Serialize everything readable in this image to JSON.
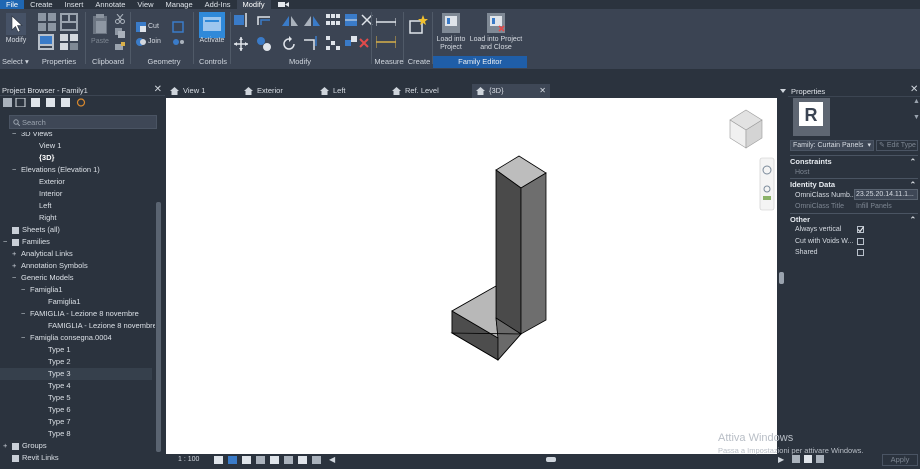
{
  "menubar": {
    "items": [
      "File",
      "Create",
      "Insert",
      "Annotate",
      "View",
      "Manage",
      "Add-Ins",
      "Modify"
    ],
    "active": "Modify"
  },
  "ribbon": {
    "modify_label": "Modify",
    "cut_label": "Cut",
    "join_label": "Join",
    "paste_label": "Paste",
    "activate_label": "Activate",
    "load_into_project_label": "Load into Project",
    "load_into_project_close_label": "Load into Project and Close",
    "panels": {
      "select": "Select",
      "properties": "Properties",
      "clipboard": "Clipboard",
      "geometry": "Geometry",
      "controls": "Controls",
      "modify": "Modify",
      "measure": "Measure",
      "create": "Create",
      "family_editor": "Family Editor"
    }
  },
  "project_browser": {
    "title": "Project Browser - Family1",
    "search_placeholder": "Search",
    "items": [
      {
        "label": "3D Views",
        "indent": 1,
        "exp": "−"
      },
      {
        "label": "View 1",
        "indent": 3,
        "exp": ""
      },
      {
        "label": "{3D}",
        "indent": 3,
        "exp": "",
        "selected": true
      },
      {
        "label": "Elevations (Elevation 1)",
        "indent": 1,
        "exp": "−"
      },
      {
        "label": "Exterior",
        "indent": 3,
        "exp": ""
      },
      {
        "label": "Interior",
        "indent": 3,
        "exp": ""
      },
      {
        "label": "Left",
        "indent": 3,
        "exp": ""
      },
      {
        "label": "Right",
        "indent": 3,
        "exp": ""
      },
      {
        "label": "Sheets (all)",
        "indent": 0,
        "exp": "",
        "icon": true
      },
      {
        "label": "Families",
        "indent": 0,
        "exp": "−",
        "icon": true
      },
      {
        "label": "Analytical Links",
        "indent": 1,
        "exp": "+"
      },
      {
        "label": "Annotation Symbols",
        "indent": 1,
        "exp": "+"
      },
      {
        "label": "Generic Models",
        "indent": 1,
        "exp": "−"
      },
      {
        "label": "Famiglia1",
        "indent": 2,
        "exp": "−"
      },
      {
        "label": "Famiglia1",
        "indent": 4,
        "exp": ""
      },
      {
        "label": "FAMIGLIA - Lezione 8 novembre",
        "indent": 2,
        "exp": "−"
      },
      {
        "label": "FAMIGLIA - Lezione 8 novembre",
        "indent": 4,
        "exp": ""
      },
      {
        "label": "Famiglia consegna.0004",
        "indent": 2,
        "exp": "−"
      },
      {
        "label": "Type 1",
        "indent": 4,
        "exp": ""
      },
      {
        "label": "Type 2",
        "indent": 4,
        "exp": ""
      },
      {
        "label": "Type 3",
        "indent": 4,
        "exp": "",
        "highlight": true
      },
      {
        "label": "Type 4",
        "indent": 4,
        "exp": ""
      },
      {
        "label": "Type 5",
        "indent": 4,
        "exp": ""
      },
      {
        "label": "Type 6",
        "indent": 4,
        "exp": ""
      },
      {
        "label": "Type 7",
        "indent": 4,
        "exp": ""
      },
      {
        "label": "Type 8",
        "indent": 4,
        "exp": ""
      },
      {
        "label": "Groups",
        "indent": 0,
        "exp": "+",
        "icon": true
      },
      {
        "label": "Revit Links",
        "indent": 0,
        "exp": "",
        "icon": true
      }
    ]
  },
  "tabs": [
    {
      "label": "View 1"
    },
    {
      "label": "Exterior"
    },
    {
      "label": "Left"
    },
    {
      "label": "Ref. Level"
    },
    {
      "label": "{3D}",
      "active": true
    }
  ],
  "status": {
    "scale": "1 : 100"
  },
  "properties": {
    "title": "Properties",
    "family_selector": "Family: Curtain Panels",
    "edit_type": "Edit Type",
    "constraints_label": "Constraints",
    "host_label": "Host",
    "identity_label": "Identity Data",
    "omniclass_number_label": "OmniClass Numb...",
    "omniclass_number_value": "23.25.20.14.11.1...",
    "omniclass_title_label": "OmniClass Title",
    "omniclass_title_value": "Infill Panels",
    "other_label": "Other",
    "always_vertical_label": "Always vertical",
    "always_vertical_checked": true,
    "cut_with_voids_label": "Cut with Voids W...",
    "cut_with_voids_checked": false,
    "shared_label": "Shared",
    "shared_checked": false,
    "apply_label": "Apply"
  },
  "watermark": {
    "line1": "Attiva Windows",
    "line2": "Passa a Impostazioni per attivare Windows."
  },
  "colors": {
    "accent": "#1f67b3",
    "ribbon_bg": "#3b4453",
    "panel_bg": "#2b333e",
    "family_editor_panel": "#1f5ea8"
  }
}
